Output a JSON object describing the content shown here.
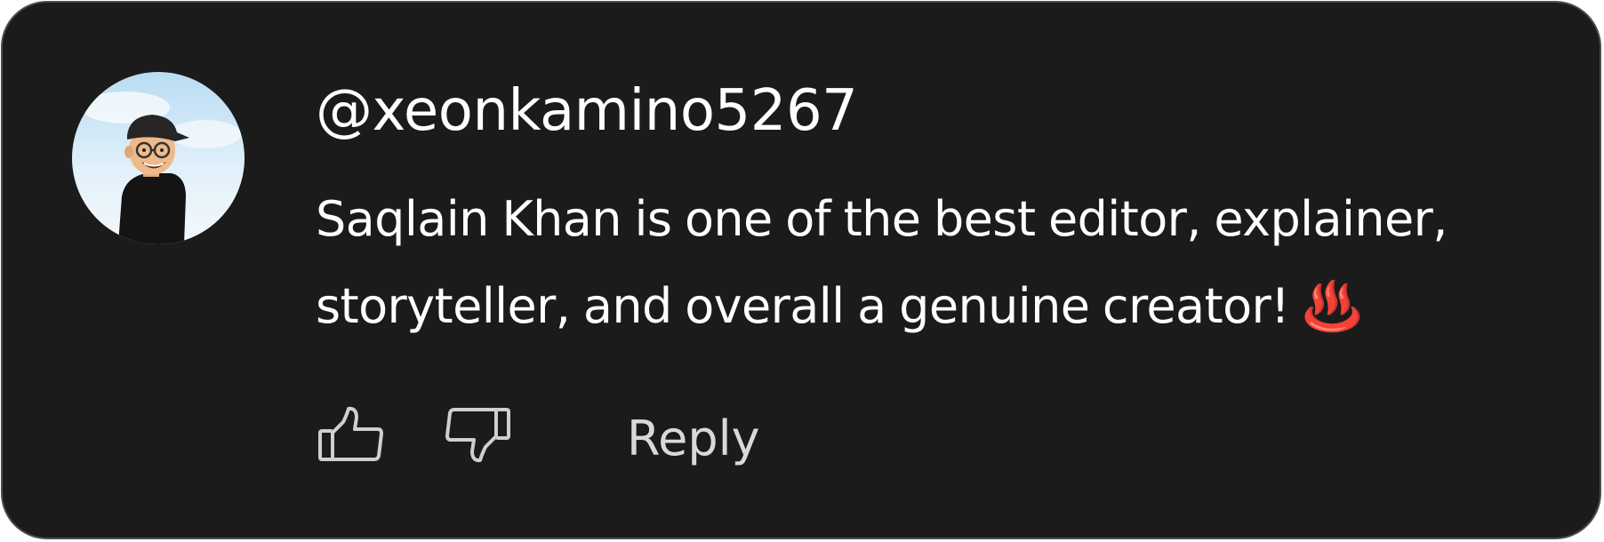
{
  "comment": {
    "username": "@xeonkamino5267",
    "text_line_1": "Saqlain Khan is one of the best editor, explainer,",
    "text_line_2": "storyteller, and overall a genuine creator! ♨️",
    "avatar_icon": "cartoon-avatar-icon"
  },
  "actions": {
    "like_icon": "thumbs-up-icon",
    "dislike_icon": "thumbs-down-icon",
    "reply_label": "Reply"
  },
  "colors": {
    "card_background": "#1b1b1b",
    "card_border": "#4d4d4d",
    "text_primary": "#ffffff",
    "text_secondary": "#d9d9d9"
  }
}
